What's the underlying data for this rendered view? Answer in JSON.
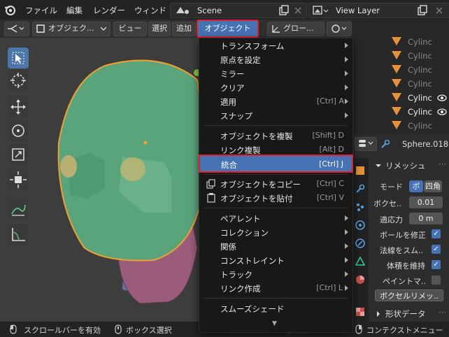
{
  "menubar": {
    "items": [
      "ファイル",
      "編集",
      "レンダー",
      "ウィンド"
    ],
    "scene": "Scene",
    "view_layer": "View Layer"
  },
  "viewport_header": {
    "mode": "オブジェク...",
    "view": "ビュー",
    "select": "選択",
    "add": "追加",
    "object": "オブジェクト",
    "orientation": "グロー..."
  },
  "object_menu": {
    "items": [
      {
        "label": "トランスフォーム",
        "submenu": true
      },
      {
        "label": "原点を設定",
        "submenu": true
      },
      {
        "label": "ミラー",
        "submenu": true
      },
      {
        "label": "クリア",
        "submenu": true
      },
      {
        "label": "適用",
        "shortcut": "[Ctrl] A",
        "submenu": true
      },
      {
        "label": "スナップ",
        "submenu": true
      },
      {
        "label": "オブジェクトを複製",
        "shortcut": "[Shift] D"
      },
      {
        "label": "リンク複製",
        "shortcut": "[Alt] D"
      },
      {
        "label": "統合",
        "shortcut": "[Ctrl] J",
        "highlighted": true
      },
      {
        "label": "オブジェクトをコピー",
        "shortcut": "[Ctrl] C",
        "icon": "copy-icon"
      },
      {
        "label": "オブジェクトを貼付",
        "shortcut": "[Ctrl] V",
        "icon": "paste-icon"
      },
      {
        "label": "ペアレント",
        "submenu": true
      },
      {
        "label": "コレクション",
        "submenu": true
      },
      {
        "label": "関係",
        "submenu": true
      },
      {
        "label": "コンストレイント",
        "submenu": true
      },
      {
        "label": "トラック",
        "submenu": true
      },
      {
        "label": "リンク作成",
        "shortcut": "[Ctrl] L",
        "submenu": true
      },
      {
        "label": "スムーズシェード"
      }
    ],
    "more_indicator": "▼"
  },
  "outliner": {
    "rows": [
      {
        "label": "Cylinc",
        "visible": false
      },
      {
        "label": "Cylinc",
        "visible": false
      },
      {
        "label": "Cylinc",
        "visible": false
      },
      {
        "label": "Cylinc",
        "visible": false
      },
      {
        "label": "Cylinc",
        "visible": true
      },
      {
        "label": "Cylinc",
        "visible": true
      },
      {
        "label": "Cylinc",
        "visible": false
      }
    ]
  },
  "properties": {
    "object_name": "Sphere.018",
    "panel_title": "リメッシュ",
    "mode_label": "モード",
    "mode_options": [
      "ボ",
      "四角"
    ],
    "voxel_label": "ボクセ..",
    "voxel_value": "0.01",
    "adaptive_label": "適応力",
    "adaptive_value": "0 m",
    "checks": [
      {
        "label": "ボールを修正",
        "checked": true
      },
      {
        "label": "法線をスム..",
        "checked": true
      },
      {
        "label": "体積を維持",
        "checked": true
      },
      {
        "label": "ペイントマ..",
        "checked": false
      }
    ],
    "voxel_button": "ボクセルリメッ..",
    "shape_data": "形状データ"
  },
  "statusbar": {
    "scroll": "スクロールバーを有効",
    "box_select": "ボックス選択",
    "scroll_hidden": "スクロールバーを有効",
    "context_menu": "コンテクストメニュー"
  },
  "colors": {
    "accent": "#4772b3",
    "highlight_box": "#e0202a",
    "object_green": "#5aa47c",
    "selection_orange": "#f0a030"
  }
}
